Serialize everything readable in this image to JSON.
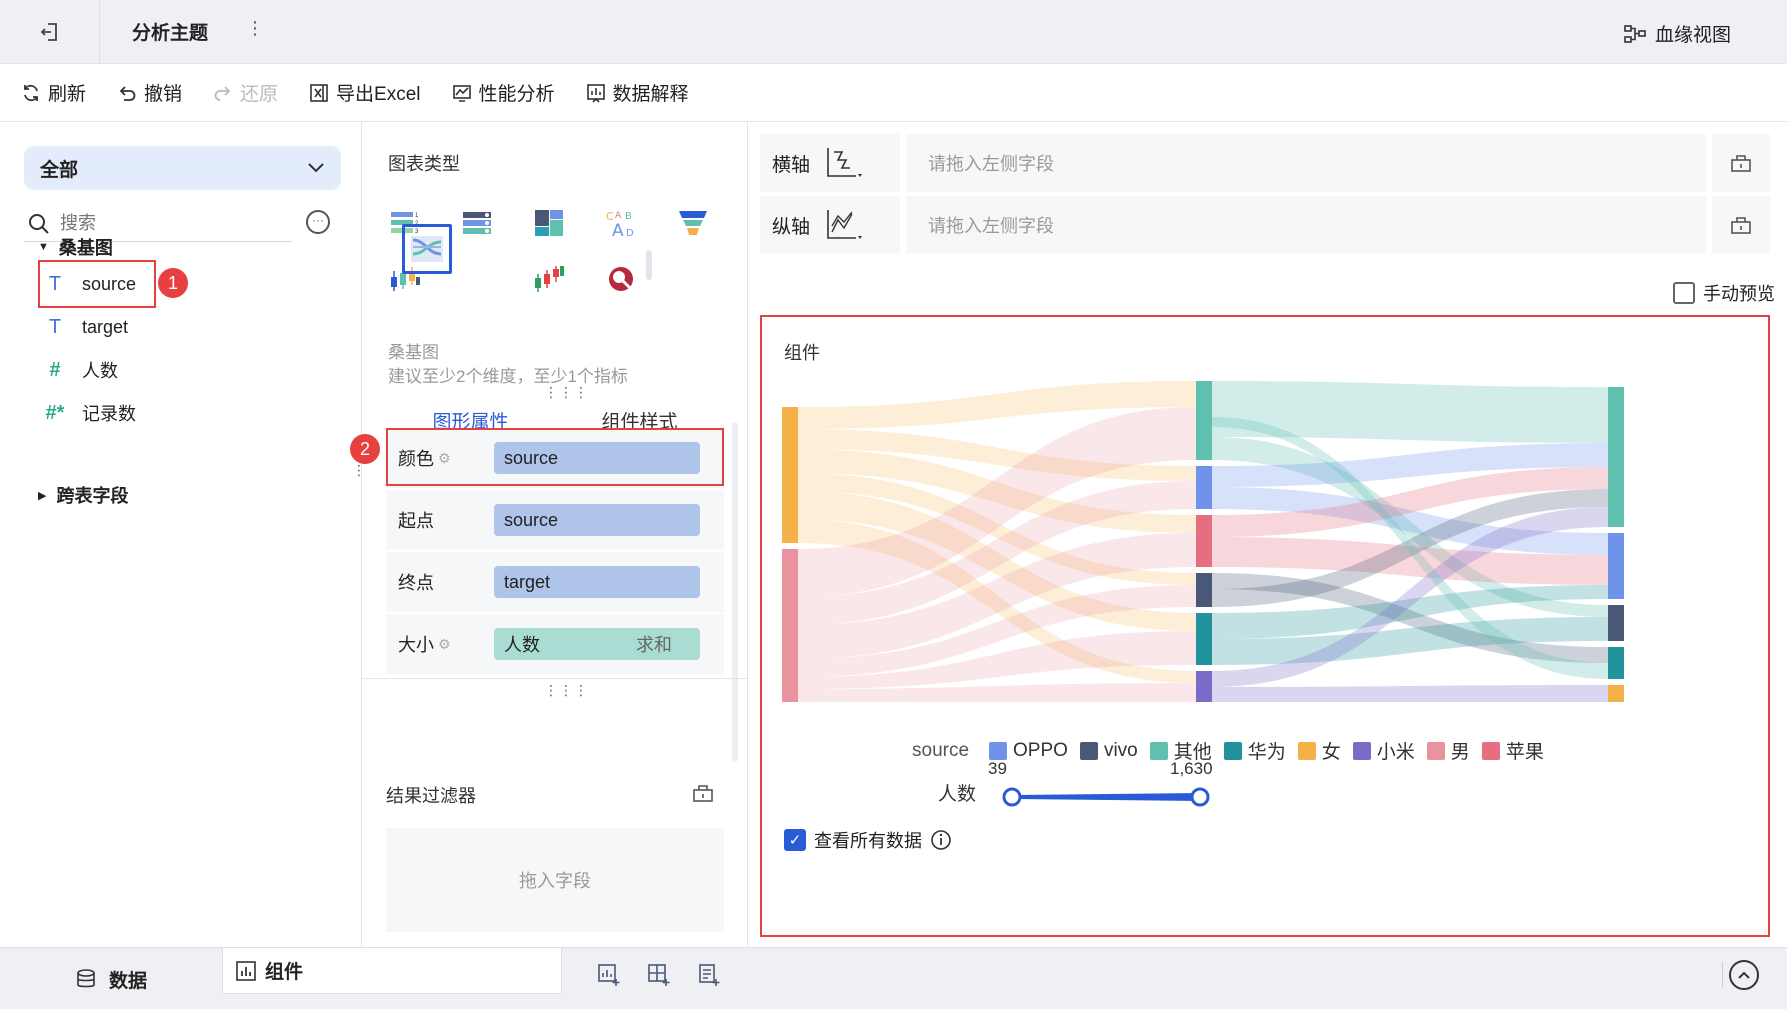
{
  "header": {
    "title": "分析主题",
    "more": "⋮",
    "lineage_label": "血缘视图"
  },
  "toolbar": {
    "refresh": "刷新",
    "undo": "撤销",
    "redo": "还原",
    "export": "导出Excel",
    "perf": "性能分析",
    "explain": "数据解释"
  },
  "left": {
    "scope": "全部",
    "search_placeholder": "搜索",
    "group1": "桑基图",
    "fields": [
      {
        "icon": "T",
        "name": "source"
      },
      {
        "icon": "T",
        "name": "target"
      },
      {
        "icon": "#",
        "name": "人数"
      },
      {
        "icon": "#*",
        "name": "记录数"
      }
    ],
    "group2": "跨表字段",
    "badge1": "1"
  },
  "middle": {
    "chart_types_label": "图表类型",
    "chart_name": "桑基图",
    "chart_hint": "建议至少2个维度，至少1个指标",
    "tabs": [
      "图形属性",
      "组件样式"
    ],
    "props": [
      {
        "label": "颜色",
        "value": "source",
        "agg": ""
      },
      {
        "label": "起点",
        "value": "source",
        "agg": ""
      },
      {
        "label": "终点",
        "value": "target",
        "agg": ""
      },
      {
        "label": "大小",
        "value": "人数",
        "agg": "求和"
      }
    ],
    "badge2": "2",
    "filter_title": "结果过滤器",
    "filter_drop": "拖入字段"
  },
  "right": {
    "x_axis_label": "横轴",
    "y_axis_label": "纵轴",
    "axis_placeholder": "请拖入左侧字段",
    "manual_preview": "手动预览",
    "widget_title": "组件",
    "legend_title": "source",
    "size_label": "人数",
    "size_min": "39",
    "size_max": "1,630",
    "view_all": "查看所有数据"
  },
  "chart_data": {
    "type": "sankey",
    "legend": [
      {
        "name": "OPPO",
        "color": "#6f93e8"
      },
      {
        "name": "vivo",
        "color": "#4a5878"
      },
      {
        "name": "其他",
        "color": "#5fc0b0"
      },
      {
        "name": "华为",
        "color": "#22939c"
      },
      {
        "name": "女",
        "color": "#f6b048"
      },
      {
        "name": "小米",
        "color": "#7b6bc8"
      },
      {
        "name": "男",
        "color": "#e8939e"
      },
      {
        "name": "苹果",
        "color": "#e56f80"
      }
    ],
    "size_range": [
      39,
      1630
    ]
  },
  "bottom": {
    "tab_data": "数据",
    "tab_widget": "组件"
  }
}
